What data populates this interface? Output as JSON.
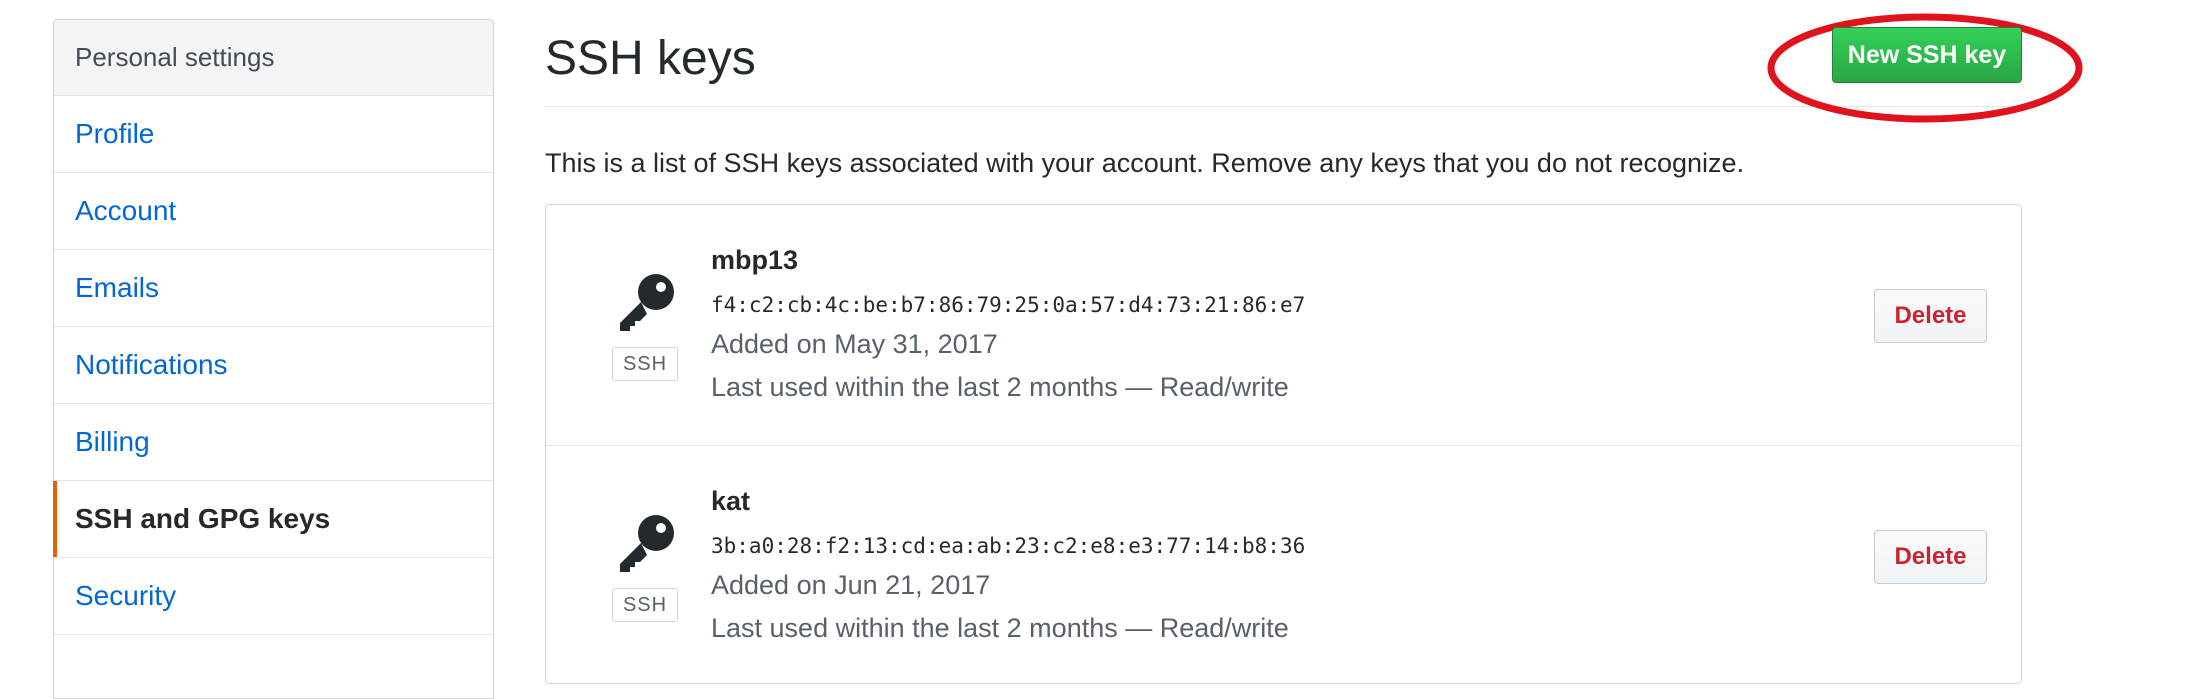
{
  "sidebar": {
    "header": "Personal settings",
    "items": [
      {
        "label": "Profile"
      },
      {
        "label": "Account"
      },
      {
        "label": "Emails"
      },
      {
        "label": "Notifications"
      },
      {
        "label": "Billing"
      },
      {
        "label": "SSH and GPG keys",
        "selected": true
      },
      {
        "label": "Security"
      }
    ]
  },
  "main": {
    "title": "SSH keys",
    "new_key_label": "New SSH key",
    "intro": "This is a list of SSH keys associated with your account. Remove any keys that you do not recognize.",
    "keys": [
      {
        "title": "mbp13",
        "fingerprint": "f4:c2:cb:4c:be:b7:86:79:25:0a:57:d4:73:21:86:e7",
        "added": "Added on May 31, 2017",
        "last_used": "Last used within the last 2 months — Read/write",
        "badge": "SSH",
        "delete_label": "Delete"
      },
      {
        "title": "kat",
        "fingerprint": "3b:a0:28:f2:13:cd:ea:ab:23:c2:e8:e3:77:14:b8:36",
        "added": "Added on Jun 21, 2017",
        "last_used": "Last used within the last 2 months — Read/write",
        "badge": "SSH",
        "delete_label": "Delete"
      }
    ]
  },
  "colors": {
    "accent_green": "#2ea44f",
    "link_blue": "#0366d6",
    "selected_marker": "#e36209",
    "danger_red": "#cb2431",
    "annotation_ring": "#e0121b"
  },
  "icons": [
    "key-icon",
    "highlight-ring"
  ]
}
